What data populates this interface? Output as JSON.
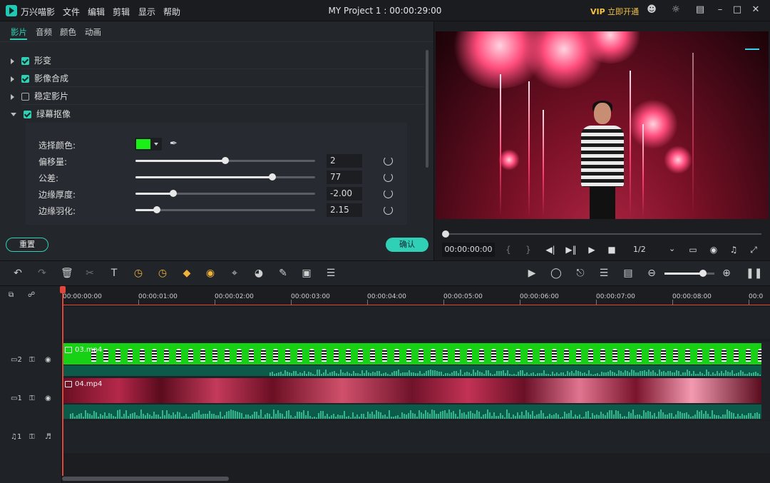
{
  "app": {
    "name": "万兴喵影",
    "project_title": "MY Project 1 : 00:00:29:00"
  },
  "menu": [
    "文件",
    "编辑",
    "剪辑",
    "显示",
    "帮助"
  ],
  "vip": {
    "label": "VIP",
    "text": "立即开通"
  },
  "panel_tabs": [
    "影片",
    "音频",
    "颜色",
    "动画"
  ],
  "sections": [
    {
      "label": "形变",
      "checked": true,
      "expanded": false
    },
    {
      "label": "影像合成",
      "checked": true,
      "expanded": false
    },
    {
      "label": "稳定影片",
      "checked": false,
      "expanded": false
    },
    {
      "label": "绿幕抠像",
      "checked": true,
      "expanded": true
    }
  ],
  "chroma": {
    "select_color_label": "选择颜色:",
    "selected_color": "#19f018",
    "params": [
      {
        "label": "偏移量:",
        "value": "2",
        "level": 0.5
      },
      {
        "label": "公差:",
        "value": "77",
        "level": 0.76
      },
      {
        "label": "边缘厚度:",
        "value": "-2.00",
        "level": 0.21
      },
      {
        "label": "边缘羽化:",
        "value": "2.15",
        "level": 0.12
      }
    ]
  },
  "buttons": {
    "reset": "重置",
    "confirm": "确认"
  },
  "preview": {
    "timecode": "00:00:00:00",
    "zoom": "1/2"
  },
  "ruler": [
    "00:00:00:00",
    "00:00:01:00",
    "00:00:02:00",
    "00:00:03:00",
    "00:00:04:00",
    "00:00:05:00",
    "00:00:06:00",
    "00:00:07:00",
    "00:00:08:00",
    "00:0"
  ],
  "tracks": {
    "video2": {
      "badge": "2",
      "clip": "03.mp4"
    },
    "video1": {
      "badge": "1",
      "clip": "04.mp4"
    },
    "audio1": {
      "badge": "1"
    }
  }
}
